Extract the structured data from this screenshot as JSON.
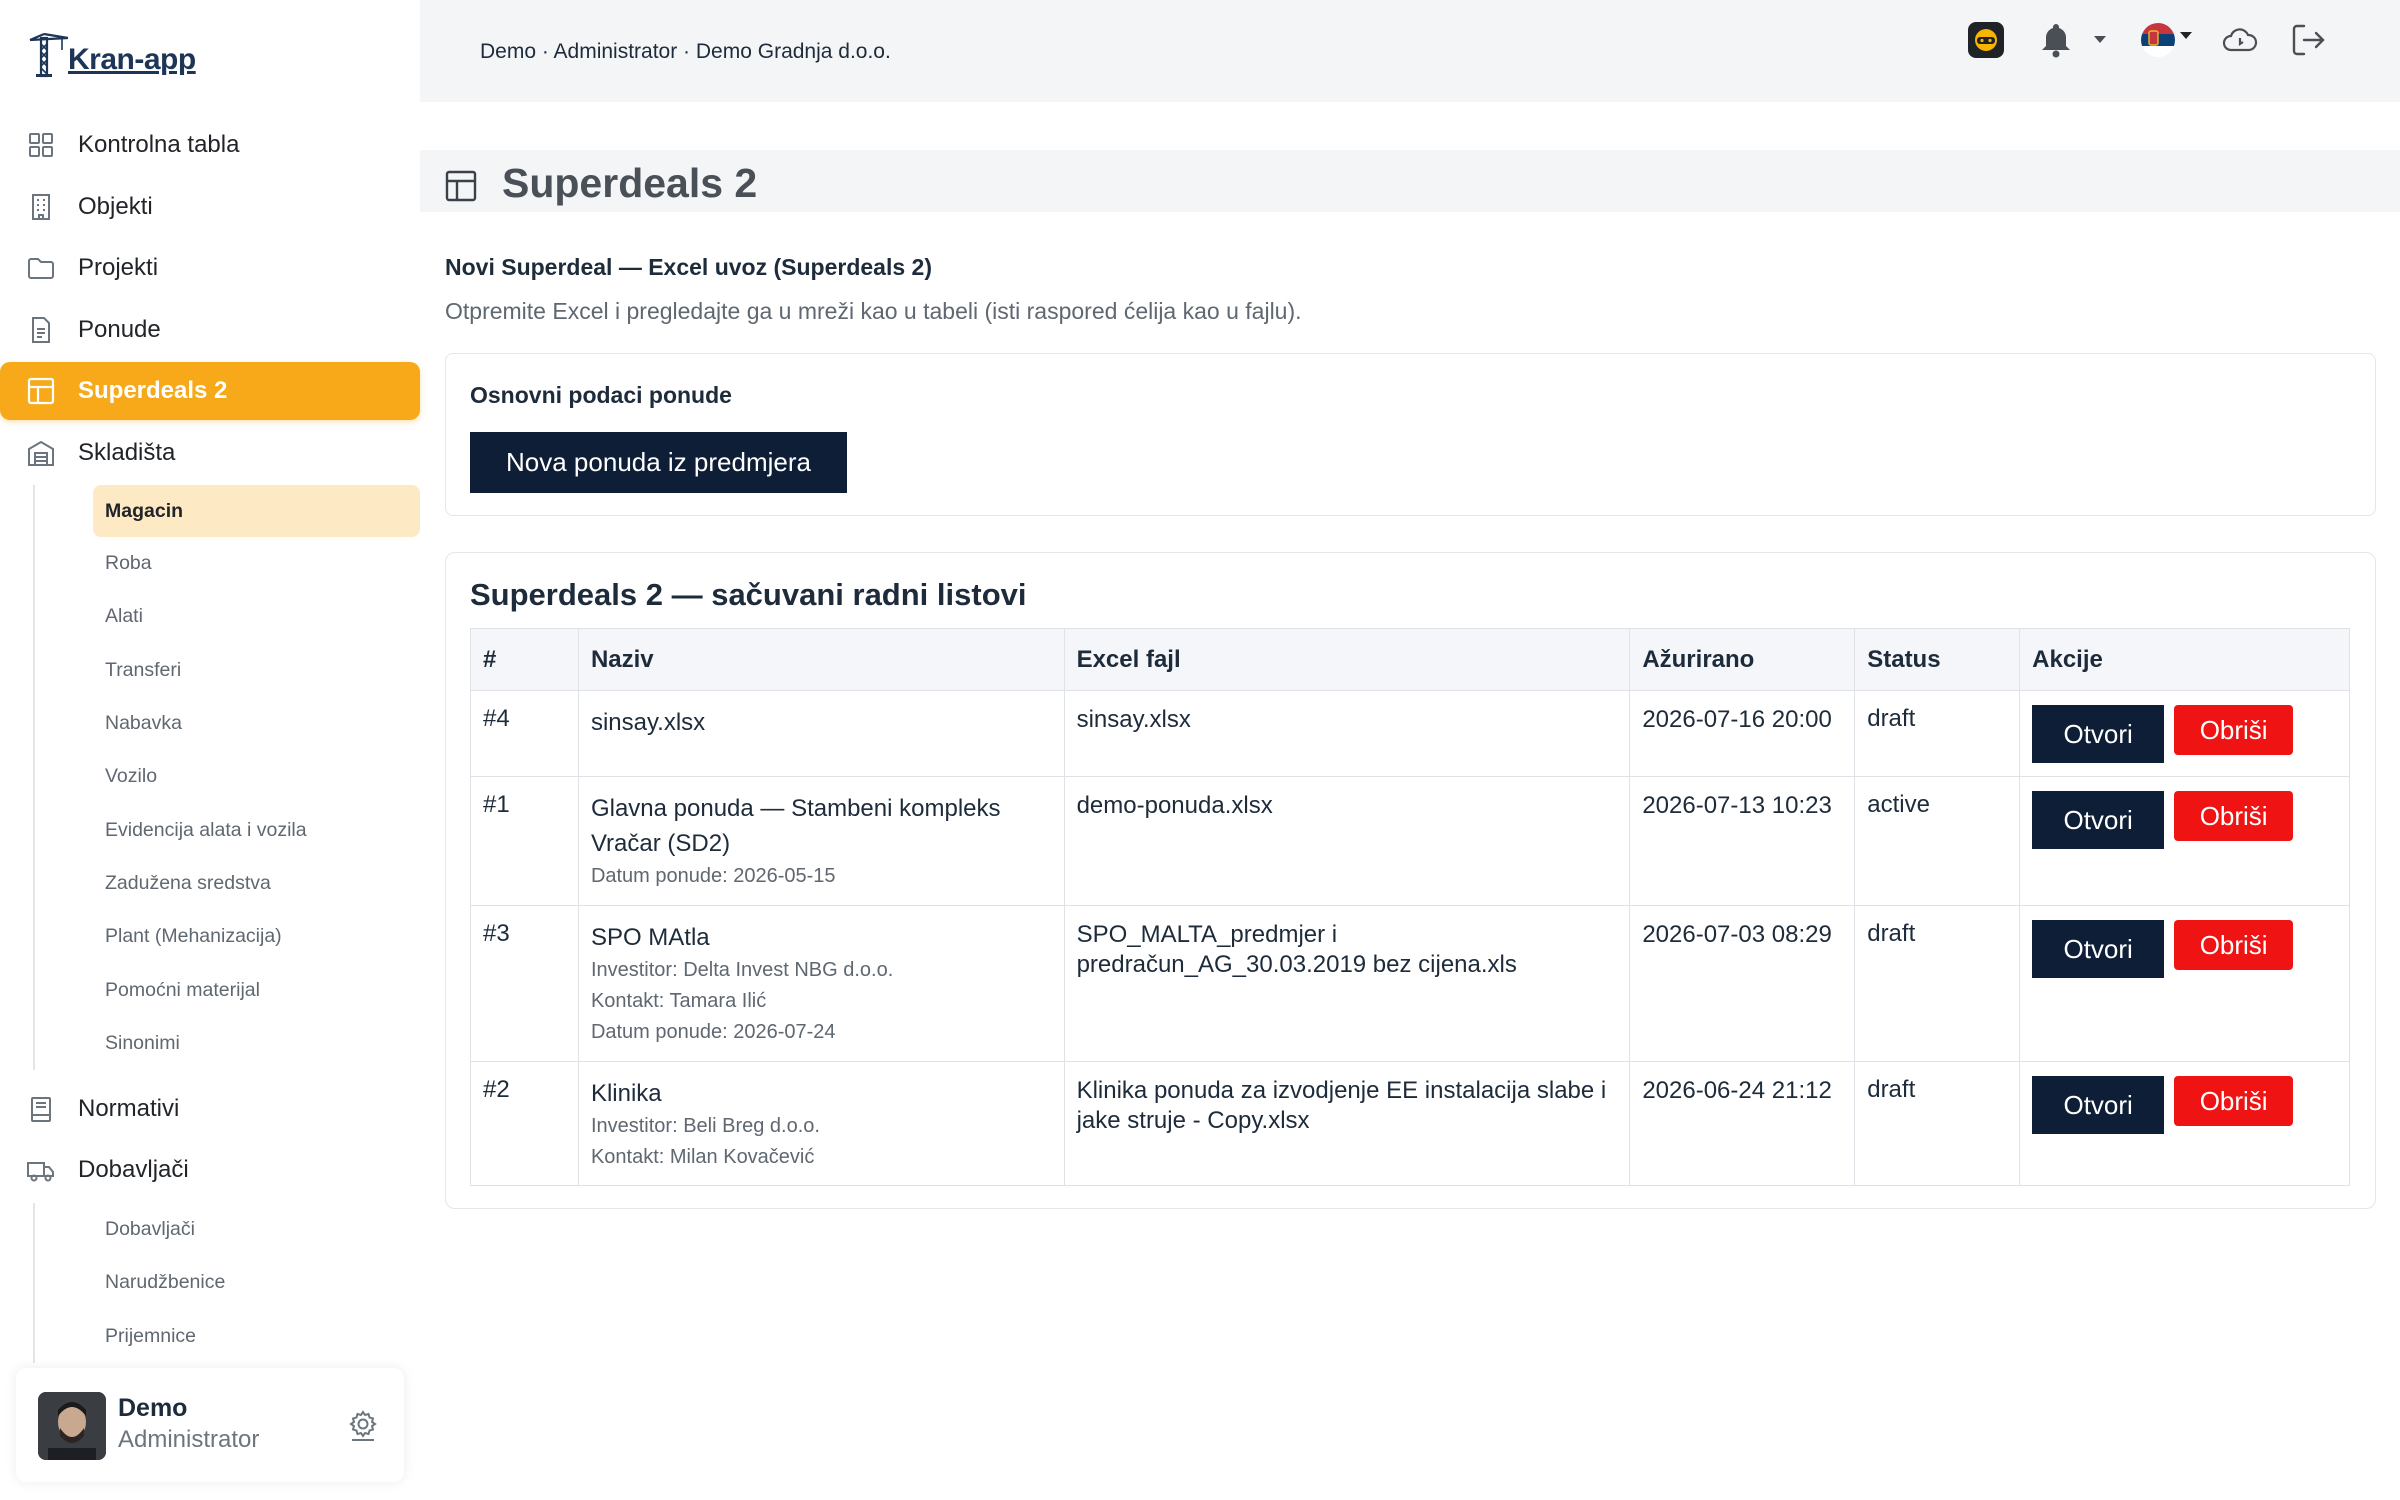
{
  "app": {
    "name": "Kran-app"
  },
  "breadcrumb": "Demo · Administrator · Demo Gradnja d.o.o.",
  "nav": [
    {
      "label": "Kontrolna tabla",
      "icon": "grid-icon"
    },
    {
      "label": "Objekti",
      "icon": "building-icon"
    },
    {
      "label": "Projekti",
      "icon": "folder-icon"
    },
    {
      "label": "Ponude",
      "icon": "document-icon"
    },
    {
      "label": "Superdeals 2",
      "icon": "table-icon",
      "active": true
    },
    {
      "label": "Skladišta",
      "icon": "warehouse-icon"
    }
  ],
  "warehouse_sub": [
    "Magacin",
    "Roba",
    "Alati",
    "Transferi",
    "Nabavka",
    "Vozilo",
    "Evidencija alata i vozila",
    "Zadužena sredstva",
    "Plant (Mehanizacija)",
    "Pomoćni materijal",
    "Sinonimi"
  ],
  "nav2": [
    {
      "label": "Normativi",
      "icon": "book-icon"
    },
    {
      "label": "Dobavljači",
      "icon": "truck-icon"
    }
  ],
  "supplier_sub": [
    "Dobavljači",
    "Narudžbenice",
    "Prijemnice"
  ],
  "user": {
    "name": "Demo",
    "role": "Administrator"
  },
  "page": {
    "title": "Superdeals 2",
    "section_title": "Novi Superdeal — Excel uvoz (Superdeals 2)",
    "section_desc": "Otpremite Excel i pregledajte ga u mreži kao u tabeli (isti raspored ćelija kao u fajlu).",
    "basic_title": "Osnovni podaci ponude",
    "new_button": "Nova ponuda iz predmjera",
    "saved_title": "Superdeals 2 — sačuvani radni listovi"
  },
  "table": {
    "headers": [
      "#",
      "Naziv",
      "Excel fajl",
      "Ažurirano",
      "Status",
      "Akcije"
    ],
    "open_label": "Otvori",
    "delete_label": "Obriši",
    "rows": [
      {
        "id": "#4",
        "name": "sinsay.xlsx",
        "meta": [],
        "file": "sinsay.xlsx",
        "updated": "2026-07-16 20:00",
        "status": "draft"
      },
      {
        "id": "#1",
        "name": "Glavna ponuda — Stambeni kompleks Vračar (SD2)",
        "meta": [
          "Datum ponude: 2026-05-15"
        ],
        "file": "demo-ponuda.xlsx",
        "updated": "2026-07-13 10:23",
        "status": "active"
      },
      {
        "id": "#3",
        "name": "SPO MAtla",
        "meta": [
          "Investitor: Delta Invest NBG d.o.o.",
          "Kontakt: Tamara Ilić",
          "Datum ponude: 2026-07-24"
        ],
        "file": "SPO_MALTA_predmjer i predračun_AG_30.03.2019 bez cijena.xls",
        "updated": "2026-07-03 08:29",
        "status": "draft"
      },
      {
        "id": "#2",
        "name": "Klinika",
        "meta": [
          "Investitor: Beli Breg d.o.o.",
          "Kontakt: Milan Kovačević"
        ],
        "file": "Klinika ponuda za izvodjenje EE instalacija slabe i jake struje - Copy.xlsx",
        "updated": "2026-06-24 21:12",
        "status": "draft"
      }
    ]
  },
  "colors": {
    "accent": "#f7a919",
    "primary": "#0e1e36",
    "danger": "#f01313"
  }
}
